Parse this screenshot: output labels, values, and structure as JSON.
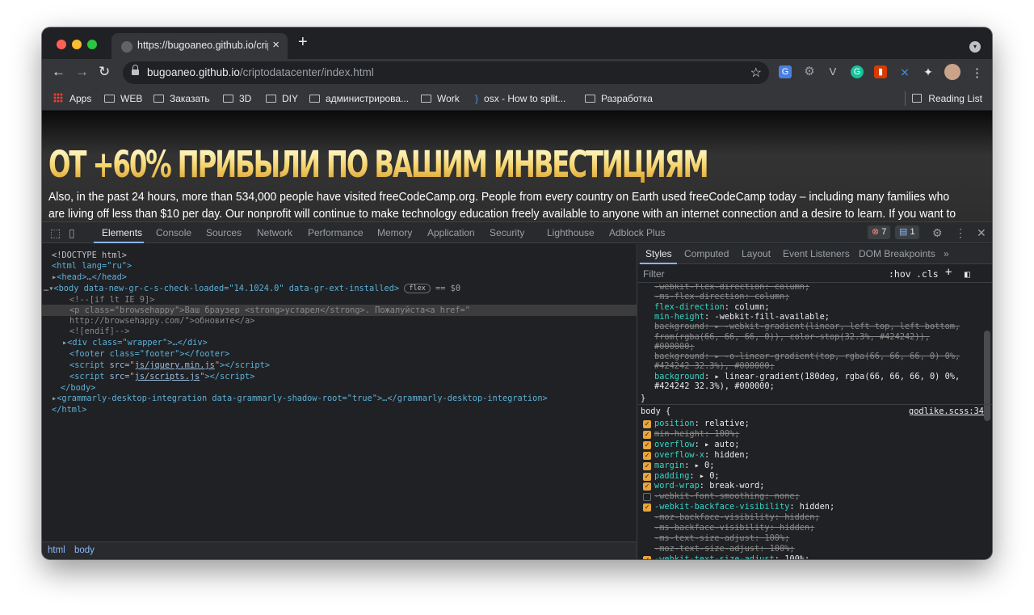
{
  "browser": {
    "tab_title": "https://bugoaneo.github.io/crip",
    "tab_close": "×",
    "new_tab": "+",
    "url_domain": "bugoaneo.github.io",
    "url_path": "/criptodatacenter/index.html",
    "nav_back": "←",
    "nav_forward": "→",
    "nav_reload": "↻",
    "star": "☆",
    "menu": "⋮",
    "traffic_colors": [
      "#ff5f57",
      "#febc2e",
      "#28c840"
    ],
    "extension_icons": [
      "translate-icon",
      "gear-icon",
      "vimeo-icon",
      "grammarly-icon",
      "office-icon",
      "cross-icon",
      "puzzle-icon",
      "avatar"
    ]
  },
  "bookmarks": {
    "items": [
      "Apps",
      "WEB",
      "Заказать",
      "3D",
      "DIY",
      "администрирова...",
      "Work",
      "osx - How to split...",
      "Разработка"
    ],
    "reading_list": "Reading List"
  },
  "page": {
    "headline": "ОТ +60% ПРИБЫЛИ ПО ВАШИМ ИНВЕСТИЦИЯМ",
    "paragraph": "Also, in the past 24 hours, more than 534,000 people have visited freeCodeCamp.org. People from every country on Earth used freeCodeCamp today – including many families who are living off less than $10 per day. Our nonprofit will continue to make technology education freely available to anyone with an internet connection and a desire to learn. If you want to support our mission, here's how"
  },
  "devtools": {
    "tabs": [
      "Elements",
      "Console",
      "Sources",
      "Network",
      "Performance",
      "Memory",
      "Application",
      "Security",
      "Lighthouse",
      "Adblock Plus"
    ],
    "active_tab": "Elements",
    "errors_count": "7",
    "messages_count": "1",
    "dom": {
      "doctype": "<!DOCTYPE html>",
      "html_open": "<html lang=\"ru\">",
      "head": "<head>…</head>",
      "body_open": "<body data-new-gr-c-s-check-loaded=\"14.1024.0\" data-gr-ext-installed>",
      "flex_badge": "flex",
      "eq_dollar": "== $0",
      "cmt_if": "<!--[if lt IE 9]>",
      "browsehappy_1": "<p class=\"browsehappy\">Ваш браузер <strong>устарел</strong>. Пожалуйста<a href=\"",
      "browsehappy_2": "http://browsehappy.com/\">обновите</a>",
      "cmt_endif": "<![endif]-->",
      "wrapper": "<div class=\"wrapper\">…</div>",
      "footer": "<footer class=\"footer\"></footer>",
      "script1": "js/jquery.min.js",
      "script2": "js/scripts.js",
      "body_close": "</body>",
      "grammarly": "<grammarly-desktop-integration data-grammarly-shadow-root=\"true\">…</grammarly-desktop-integration>",
      "html_close": "</html>"
    },
    "breadcrumbs": [
      "html",
      "body"
    ],
    "styles": {
      "tabs": [
        "Styles",
        "Computed",
        "Layout",
        "Event Listeners",
        "DOM Breakpoints",
        "»"
      ],
      "filter_placeholder": "Filter",
      "hov": ":hov",
      "cls": ".cls",
      "source_link": "godlike.scss:34",
      "selector": "body {",
      "close_brace": "}",
      "upper_lines": [
        {
          "t": "-webkit-flex-direction: column;",
          "strike": true
        },
        {
          "t": "-ms-flex-direction: column;",
          "strike": true
        },
        {
          "t": "flex-direction: column;",
          "strike": false
        },
        {
          "t": "min-height: -webkit-fill-available;",
          "strike": false
        },
        {
          "t": "background: ▸ -webkit-gradient(linear, left top, left bottom,",
          "strike": true
        },
        {
          "t": "  from(rgba(66, 66, 66, 0)), color-stop(32.3%, #424242)),",
          "strike": true
        },
        {
          "t": "  #000000;",
          "strike": true
        },
        {
          "t": "background: ▸ -o-linear-gradient(top, rgba(66, 66, 66, 0) 0%,",
          "strike": true
        },
        {
          "t": "  #424242 32.3%), #000000;",
          "strike": true
        },
        {
          "t": "background: ▸ linear-gradient(180deg, rgba(66, 66, 66, 0) 0%,",
          "strike": false
        },
        {
          "t": "  #424242 32.3%), #000000;",
          "strike": false
        }
      ],
      "body_props": [
        {
          "t": "position: relative;",
          "strike": false,
          "checked": true
        },
        {
          "t": "min-height: 100%;",
          "strike": true,
          "checked": true
        },
        {
          "t": "overflow: ▸ auto;",
          "strike": false,
          "checked": true
        },
        {
          "t": "overflow-x: hidden;",
          "strike": false,
          "checked": true
        },
        {
          "t": "margin: ▸ 0;",
          "strike": false,
          "checked": true
        },
        {
          "t": "padding: ▸ 0;",
          "strike": false,
          "checked": true
        },
        {
          "t": "word-wrap: break-word;",
          "strike": false,
          "checked": true
        },
        {
          "t": "-webkit-font-smoothing: none;",
          "strike": true,
          "checked": false
        },
        {
          "t": "-webkit-backface-visibility: hidden;",
          "strike": false,
          "checked": true
        },
        {
          "t": "-moz-backface-visibility: hidden;",
          "strike": true,
          "checked": false,
          "nobox": true
        },
        {
          "t": "-ms-backface-visibility: hidden;",
          "strike": true,
          "checked": false,
          "nobox": true
        },
        {
          "t": "-ms-text-size-adjust: 100%;",
          "strike": true,
          "checked": false,
          "nobox": true
        },
        {
          "t": "-moz-text-size-adjust: 100%;",
          "strike": true,
          "checked": false,
          "nobox": true
        },
        {
          "t": "-webkit-text-size-adjust: 100%;",
          "strike": false,
          "checked": true
        }
      ]
    }
  }
}
